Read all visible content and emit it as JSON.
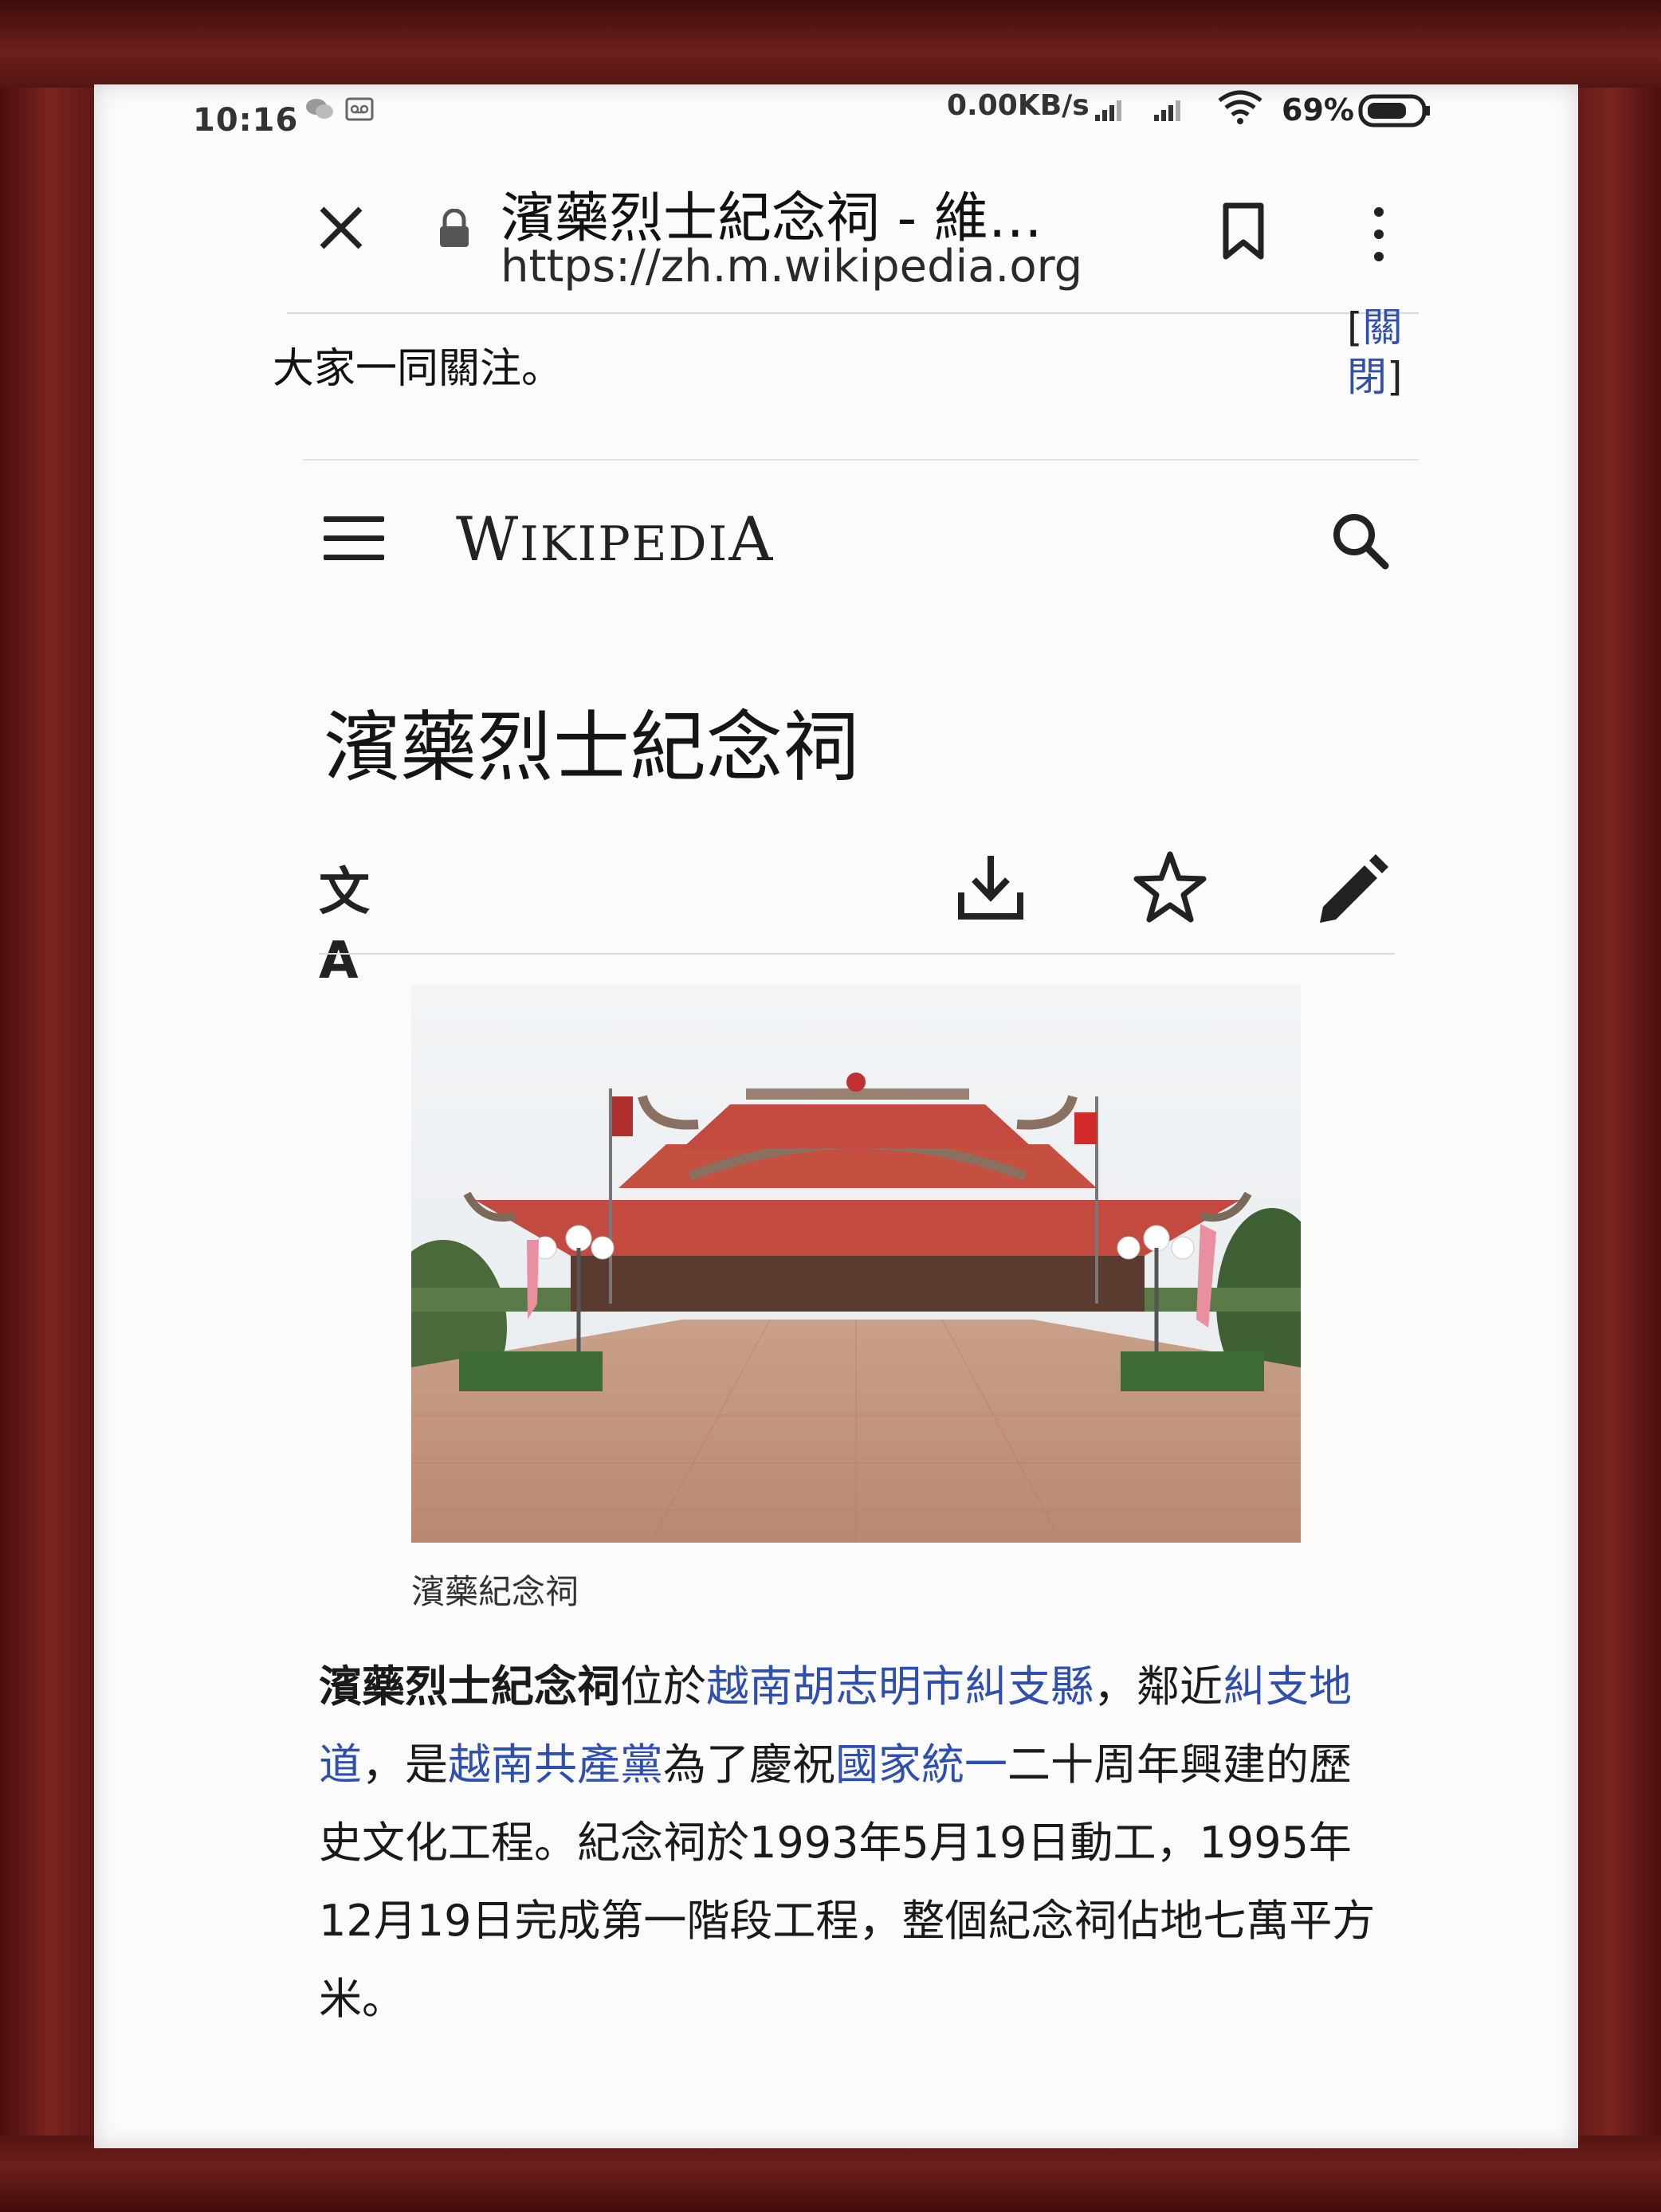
{
  "status_bar": {
    "time": "10:16",
    "net_speed": "0.00KB/s",
    "battery": "69%"
  },
  "browser": {
    "tab_title": "濱藥烈士紀念祠 - 維…",
    "url": "https://zh.m.wikipedia.org"
  },
  "banner": {
    "text": "大家一同關注。",
    "close_open": "[",
    "close_label_1": "關",
    "close_label_2": "閉",
    "close_close": "]"
  },
  "wiki": {
    "logo": "Wikipedia",
    "page_title": "濱藥烈士紀念祠",
    "lang_icon_text": "文A",
    "image_caption": "濱藥紀念祠"
  },
  "article": {
    "segments": [
      {
        "t": "濱藥烈士紀念祠",
        "k": "b"
      },
      {
        "t": "位於",
        "k": ""
      },
      {
        "t": "越南胡志明市糾支縣",
        "k": "lnk"
      },
      {
        "t": "，鄰近",
        "k": ""
      },
      {
        "t": "糾支地道",
        "k": "lnk"
      },
      {
        "t": "，是",
        "k": ""
      },
      {
        "t": "越南共產黨",
        "k": "lnk"
      },
      {
        "t": "為了慶祝",
        "k": ""
      },
      {
        "t": "國家統一",
        "k": "lnk"
      },
      {
        "t": "二十周年興建的歷史文化工程。紀念祠於1993年5月19日動工，1995年12月19日完成第一階段工程，整個紀念祠佔地七萬平方米。",
        "k": ""
      }
    ]
  }
}
